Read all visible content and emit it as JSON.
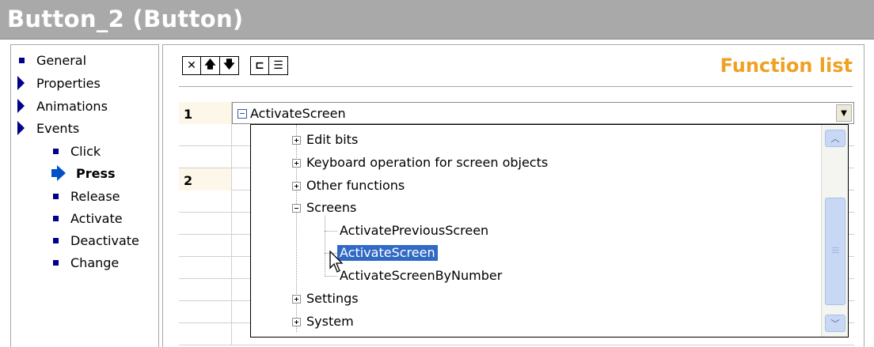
{
  "window": {
    "title": "Button_2 (Button)"
  },
  "nav": {
    "general": "General",
    "properties": "Properties",
    "animations": "Animations",
    "events": "Events",
    "click": "Click",
    "press": "Press",
    "release": "Release",
    "activate": "Activate",
    "deactivate": "Deactivate",
    "change": "Change"
  },
  "toolbar": {
    "delete_glyph": "✕",
    "up_glyph": "🡅",
    "down_glyph": "🡇",
    "indent_glyph": "⊏",
    "list_glyph": "☰"
  },
  "function_list": {
    "title": "Function list",
    "rows": [
      {
        "number": "1",
        "value": "ActivateScreen"
      },
      {
        "number": "2",
        "value": ""
      }
    ]
  },
  "dropdown": {
    "items": [
      {
        "label": "Edit bits"
      },
      {
        "label": "Keyboard operation for screen objects"
      },
      {
        "label": "Other functions"
      },
      {
        "label": "Screens"
      },
      {
        "label": "ActivatePreviousScreen"
      },
      {
        "label": "ActivateScreen"
      },
      {
        "label": "ActivateScreenByNumber"
      },
      {
        "label": "Settings"
      },
      {
        "label": "System"
      }
    ]
  },
  "colors": {
    "title_bg": "#a9a9a9",
    "accent_orange": "#f0a024",
    "nav_marker": "#00008b",
    "selection": "#316ac5",
    "row_highlight": "#fdf7ea"
  },
  "icons": {
    "dropdown_button": "chevron-down-icon",
    "scroll_up": "scroll-up-icon",
    "scroll_down": "scroll-down-icon",
    "cursor": "mouse-pointer-icon"
  }
}
